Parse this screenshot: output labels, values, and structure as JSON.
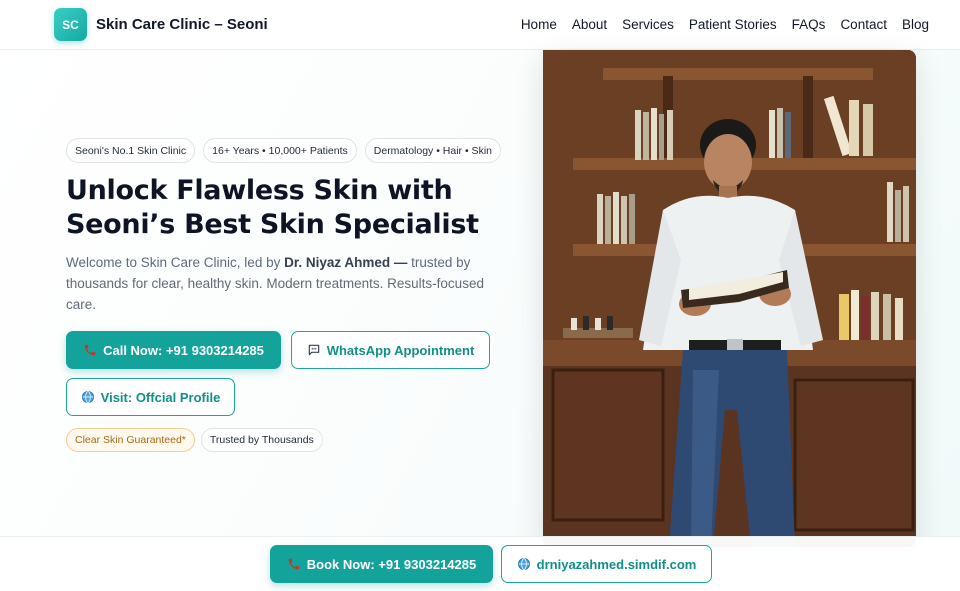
{
  "brand": {
    "logo_text": "SC",
    "name": "Skin Care Clinic – Seoni"
  },
  "nav": [
    "Home",
    "About",
    "Services",
    "Patient Stories",
    "FAQs",
    "Contact",
    "Blog"
  ],
  "chips": [
    "Seoni's No.1 Skin Clinic",
    "16+ Years • 10,000+ Patients",
    "Dermatology • Hair • Skin"
  ],
  "hero": {
    "title_line1": "Unlock Flawless Skin with",
    "title_line2": "Seoni’s Best Skin Specialist",
    "desc_prefix": "Welcome to Skin Care Clinic, led by ",
    "desc_doctor": "Dr. Niyaz Ahmed —",
    "desc_suffix": " trusted by thousands for clear, healthy skin. Modern treatments. Results-focused care."
  },
  "buttons": {
    "call": "Call Now: +91 9303214285",
    "whatsapp": "WhatsApp Appointment",
    "visit": "Visit: Offcial Profile"
  },
  "tags": [
    "Clear Skin Guaranteed*",
    "Trusted by Thousands"
  ],
  "bottom": {
    "book": "Book Now: +91 9303214285",
    "site": "drniyazahmed.simdif.com"
  },
  "icons": {
    "phone": "phone-icon",
    "chat": "chat-icon",
    "globe": "globe-icon"
  },
  "colors": {
    "accent": "#14a39a",
    "gold_tag": "#a56a17"
  }
}
